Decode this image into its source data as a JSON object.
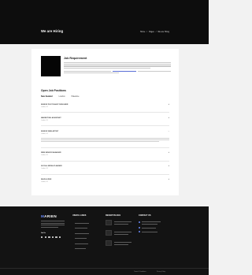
{
  "header": {
    "title": "We are Hiring",
    "breadcrumbs": [
      "Home",
      "/",
      "Pages",
      "/",
      "We are Hiring"
    ]
  },
  "requirement": {
    "title": "Job Requirement"
  },
  "positions": {
    "title": "Open Job Positions",
    "cities": [
      "New Zealand",
      "London",
      "Palestine"
    ],
    "jobs": [
      {
        "name": "SENIOR PHOTOSHOP DESIGNER",
        "location": "London, UK",
        "toggle": "+"
      },
      {
        "name": "MARKETING ASSISTANT",
        "location": "London, UK",
        "toggle": "+"
      },
      {
        "name": "SENIOR WEB ARTIST",
        "location": "London, UK",
        "toggle": "−"
      },
      {
        "name": "WEB SENIOR MANAGER",
        "location": "London, UK",
        "toggle": "+"
      },
      {
        "name": "SOCIAL MEDIA PLANNER",
        "location": "London, UK",
        "toggle": "+"
      },
      {
        "name": "DEVELOPER",
        "location": "London, UK",
        "toggle": "+"
      }
    ]
  },
  "footer": {
    "brand_main": "ARIEN",
    "brand_first": "M",
    "follow_label": "Get Us",
    "columns": {
      "links_title": "USEFUL LINKS",
      "blog_title": "RECENT BLOGS",
      "contact_title": "CONTACT US"
    },
    "bottom_links": [
      "Terms & Conditions",
      "Privacy Policy"
    ]
  },
  "colors": {
    "accent": "#6c8cff",
    "hero_bg": "#0d0d0d",
    "footer_bg": "#131313"
  }
}
